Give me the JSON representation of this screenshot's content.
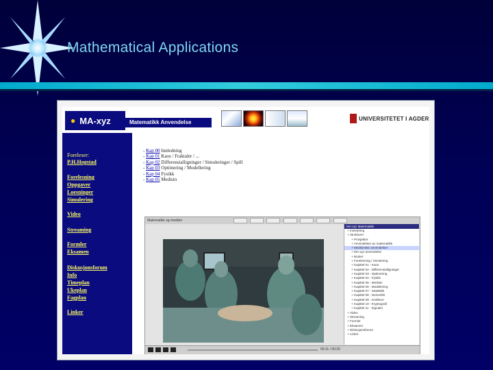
{
  "slide": {
    "title": "Mathematical Applications"
  },
  "screenshot": {
    "logo": "MA-xyz",
    "subtitle": "Matematikk Anvendelse",
    "university": "UNIVERSITETET I AGDER",
    "sidebar": {
      "lecturer_label": "Foreleser:",
      "lecturer_name": "P.H.Hogstad",
      "links": [
        "Forelesning",
        "Oppgaver",
        "Loesninger",
        "Simulering",
        "Video",
        "Streaming",
        "Formler",
        "Eksamen",
        "Diskusjonsforum",
        "Info",
        "Timeplan",
        "Ukeplan",
        "Fagplan",
        "Linker"
      ]
    },
    "chapters": [
      {
        "link": "Kap 00",
        "text": "Innledning"
      },
      {
        "link": "Kap 01",
        "text": "Kaos / Fraktaler / ..."
      },
      {
        "link": "Kap 02",
        "text": "Differensialligninger / Simuleringer / Spill"
      },
      {
        "link": "Kap 03",
        "text": "Optimering / Modellering"
      },
      {
        "link": "Kap 04",
        "text": "Fysikk"
      },
      {
        "link": "Kap 05",
        "text": "Medisin"
      }
    ],
    "player": {
      "window_title": "Matematikk og medisin",
      "tabs": [
        "Play",
        "Index",
        "Notes",
        "Slides",
        "Links",
        "Info",
        "Help"
      ],
      "time": "00:11 / 00:20",
      "tree_title": "MA-xyz Matematikk",
      "tree": [
        "Innledning",
        "Strukturer",
        "Prosjekter",
        "Anvendelser av matematikk",
        "Medisinske anvendelser",
        "MA-xyz anvendelse",
        "Bruker",
        "Forelesning / Simulering",
        "Kapittel 01 - Kaos",
        "Kapittel 02 - Differensialligninger",
        "Kapittel 03 - Optimering",
        "Kapittel 04 - Fysikk",
        "Kapittel 05 - Medisin",
        "Kapittel 06 - Modellering",
        "Kapittel 07 - Statistikk",
        "Kapittel 08 - Numerikk",
        "Kapittel 09 - Grafteori",
        "Kapittel 10 - Kryptografi",
        "Kapittel 11 - Signaler",
        "Video",
        "Streaming",
        "Formler",
        "Eksamen",
        "Diskusjonsforum",
        "Linker"
      ]
    }
  }
}
